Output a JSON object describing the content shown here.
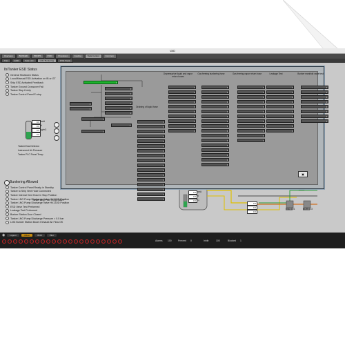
{
  "app": {
    "title": "VAD",
    "menu": [
      "Overview",
      "BUNKER",
      "PROPS",
      "FWD",
      "Propulsion",
      "Cooling",
      "Tank Control",
      "Common"
    ],
    "menu_active": 6,
    "subtabs": [
      "Trim",
      "ESD",
      "Safe Link",
      "LNG Bunkering",
      "PTO Trunk"
    ],
    "subtabs_active": 3
  },
  "tanker_esd": {
    "title": "Ib/Tanker ESD Status",
    "items": [
      "General Shutdown Status",
      "Local/Manual ESD Activation on IB or GT",
      "Ship ESD Activated Feedback",
      "Tanker Ground Crossover Fail",
      "Tanker Stop 6 ship",
      "Tanker Control Panel E-stop"
    ],
    "readings": [
      {
        "label": "barA",
        "value": "0.6"
      },
      {
        "label": "%",
        "value": "0.0"
      },
      {
        "label": "kg/m3",
        "value": "0.0"
      },
      {
        "label": "",
        "value": "0.0"
      }
    ],
    "detect_labels": [
      "Tanker/Gas Detector",
      "Instrument Air Pressure",
      "Tanker PLC Panel Temp"
    ],
    "ship_plan": "Tanker Ship Plan Temperature"
  },
  "bunkering": {
    "title": "Bunkering Allowed",
    "items": [
      "Tanker Control Panel Ready in Standby",
      "Tanker to Ship Vent Hose Connected",
      "Tanker Internal Vent Hose in Stop Position",
      "Tanker LNG Pump Discharge Valve HV-DOD Position",
      "Tanker LNG Pump Discharge Valve HV-DOD Position",
      "ESD Valve Test Performed",
      "Leakage Test Performed",
      "Bunker Station Door Closed",
      "Tanker LNG Pump Discharge Pressure > 0.5 bar",
      "LNG Bunker Station Boom Exhaust Air Flow OK"
    ],
    "readings": [
      {
        "label": "barA",
        "value": "0.0"
      },
      {
        "label": "%",
        "value": "0.0"
      },
      {
        "label": "°C",
        "value": "0.0"
      }
    ],
    "right_fields": [
      "0.0",
      "0.0",
      "0.0"
    ],
    "valve_labels": [
      "ESD 001",
      "BOR 003"
    ]
  },
  "dialog": {
    "columns": [
      {
        "head": "Draining of liquid hose"
      },
      {
        "head": "Depressurize liquid and vapor return hoses"
      },
      {
        "head": "Gas freeing bunkering hose"
      },
      {
        "head": "Gas freeing vapor return hose"
      },
      {
        "head": "Leakage Test"
      },
      {
        "head": "Bunker manifold valve test"
      }
    ],
    "close_icon": "window-close-icon"
  },
  "statusbar": {
    "pills": [
      "Logout",
      "Officer",
      "BOR",
      "Pilot"
    ],
    "warn_index": 1,
    "stats": [
      {
        "label": "Alarms",
        "value": "100"
      },
      {
        "label": "Prevent",
        "value": "0"
      },
      {
        "label": "Inhib",
        "value": "100"
      },
      {
        "label": "Blocked",
        "value": "1"
      }
    ]
  }
}
